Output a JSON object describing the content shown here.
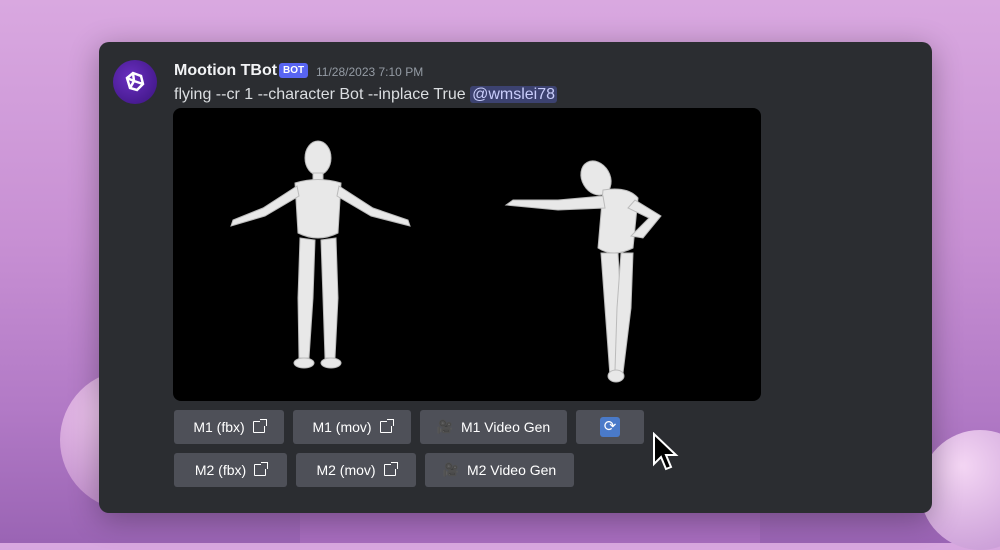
{
  "message": {
    "author": "Mootion TBot",
    "badge": "BOT",
    "timestamp": "11/28/2023 7:10 PM",
    "text": "flying --cr 1 --character Bot --inplace True ",
    "mention": "@wmslei78"
  },
  "buttons": {
    "m1_fbx": "M1 (fbx)",
    "m1_mov": "M1 (mov)",
    "m1_video": "M1 Video Gen",
    "refresh_icon": "🔄",
    "m2_fbx": "M2 (fbx)",
    "m2_mov": "M2 (mov)",
    "m2_video": "M2 Video Gen"
  },
  "icons": {
    "video": "🎥"
  }
}
